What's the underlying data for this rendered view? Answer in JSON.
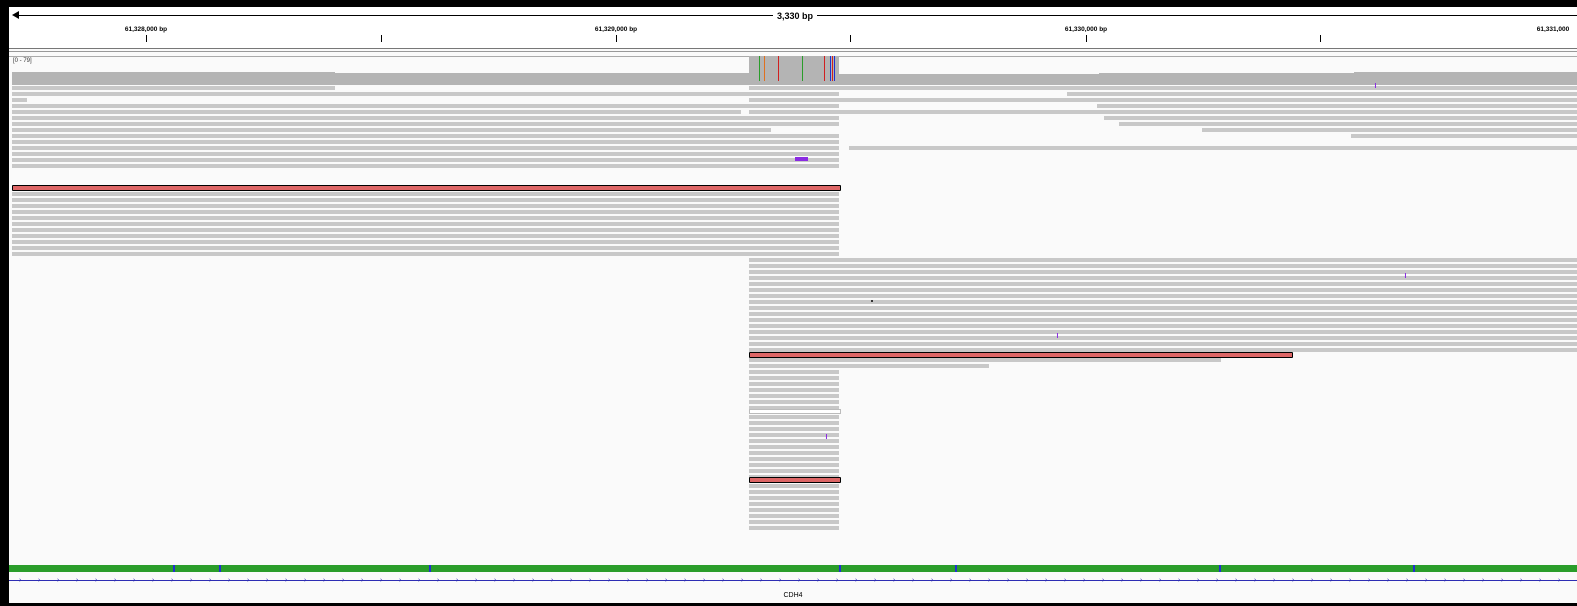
{
  "ruler": {
    "span_label": "3,330 bp",
    "ticks": [
      "61,328,000 bp",
      "61,329,000 bp",
      "61,330,000 bp",
      "61,331,000"
    ]
  },
  "coverage": {
    "range_label": "[0 - 79]"
  },
  "gene": {
    "name": "CDH4"
  },
  "colors": {
    "read": "#c8c8c8",
    "highlight_read": "#d66666",
    "insertion": "#8a2be2",
    "coverage": "#b4b4b4",
    "gene": "#2d2db4"
  }
}
